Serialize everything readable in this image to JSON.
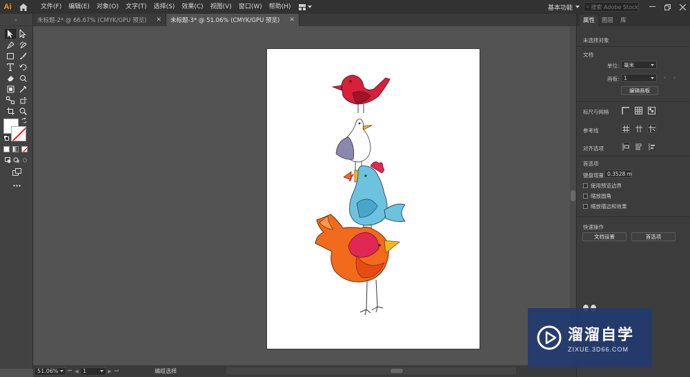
{
  "app": {
    "logo": "Ai"
  },
  "menu": {
    "items": [
      "文件(F)",
      "编辑(E)",
      "对象(O)",
      "文字(T)",
      "选择(S)",
      "效果(C)",
      "视图(V)",
      "窗口(W)",
      "帮助(H)"
    ],
    "workspace": "基本功能",
    "search_placeholder": "搜索 Adobe Stock"
  },
  "tabs": [
    {
      "label": "未标题-2* @ 66.67% (CMYK/GPU 预览)",
      "active": false
    },
    {
      "label": "未标题-3* @ 51.06% (CMYK/GPU 预览)",
      "active": true
    }
  ],
  "panel": {
    "tabs": [
      "属性",
      "图层",
      "库"
    ],
    "no_selection": "未选择对象",
    "document_title": "文档",
    "units_label": "单位:",
    "units_value": "毫米",
    "artboard_label": "画板:",
    "artboard_value": "1",
    "edit_artboards": "编辑画板",
    "rulers_grids": "标尺与网格",
    "guides": "参考线",
    "align_options": "对齐选项",
    "preferences_title": "首选项",
    "keyboard_increment_label": "键盘增量",
    "keyboard_increment_value": "0.3528 m",
    "checkboxes": [
      "使用预览边界",
      "缩放圆角",
      "缩放描边和效果"
    ],
    "quick_actions": "快速操作",
    "doc_setup": "文档设置",
    "preferences_btn": "首选项"
  },
  "status": {
    "zoom": "51.06%",
    "page": "1",
    "tool_status": "编组选择"
  },
  "watermark": {
    "title": "溜溜自学",
    "url": "ZIXUE.3D66.COM"
  },
  "colors": {
    "accent": "#ff9a00",
    "bird_red": "#d8203a",
    "chicken_blue": "#6cc3e0",
    "hen_orange": "#f26a1b",
    "comb_pink": "#e02857",
    "beak_yellow": "#f6b71d"
  }
}
